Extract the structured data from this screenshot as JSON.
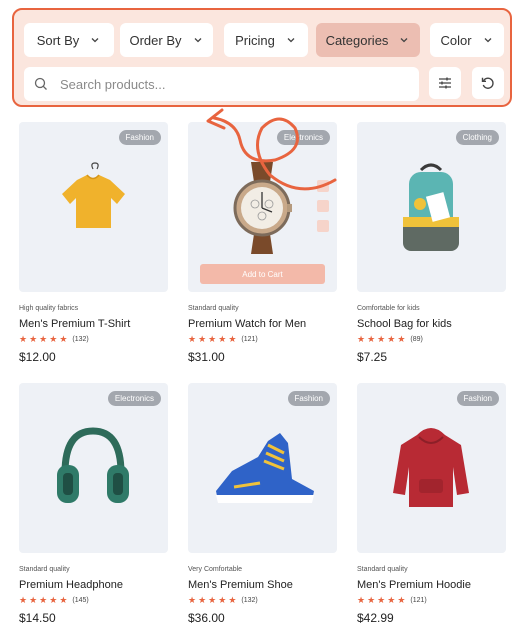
{
  "filters": {
    "sort_by": "Sort By",
    "order_by": "Order By",
    "pricing": "Pricing",
    "categories": "Categories",
    "color": "Color"
  },
  "search": {
    "placeholder": "Search products..."
  },
  "colors": {
    "accent": "#e8643f",
    "panel_bg": "#fbe6de",
    "active_chip": "#ecbeb2"
  },
  "products": [
    {
      "badge": "Fashion",
      "subtitle": "High quality fabrics",
      "name": "Men's Premium T-Shirt",
      "reviews": "(132)",
      "price": "$12.00",
      "rating": 5
    },
    {
      "badge": "Electronics",
      "subtitle": "Standard quality",
      "name": "Premium Watch for Men",
      "reviews": "(121)",
      "price": "$31.00",
      "rating": 5,
      "cta": "Add to Cart"
    },
    {
      "badge": "Clothing",
      "subtitle": "Comfortable for kids",
      "name": "School Bag for kids",
      "reviews": "(89)",
      "price": "$7.25",
      "rating": 5
    },
    {
      "badge": "Electronics",
      "subtitle": "Standard quality",
      "name": "Premium Headphone",
      "reviews": "(145)",
      "price": "$14.50",
      "rating": 5
    },
    {
      "badge": "Fashion",
      "subtitle": "Very Comfortable",
      "name": "Men's Premium Shoe",
      "reviews": "(132)",
      "price": "$36.00",
      "rating": 5
    },
    {
      "badge": "Fashion",
      "subtitle": "Standard quality",
      "name": "Men's Premium Hoodie",
      "reviews": "(121)",
      "price": "$42.99",
      "rating": 5
    }
  ]
}
